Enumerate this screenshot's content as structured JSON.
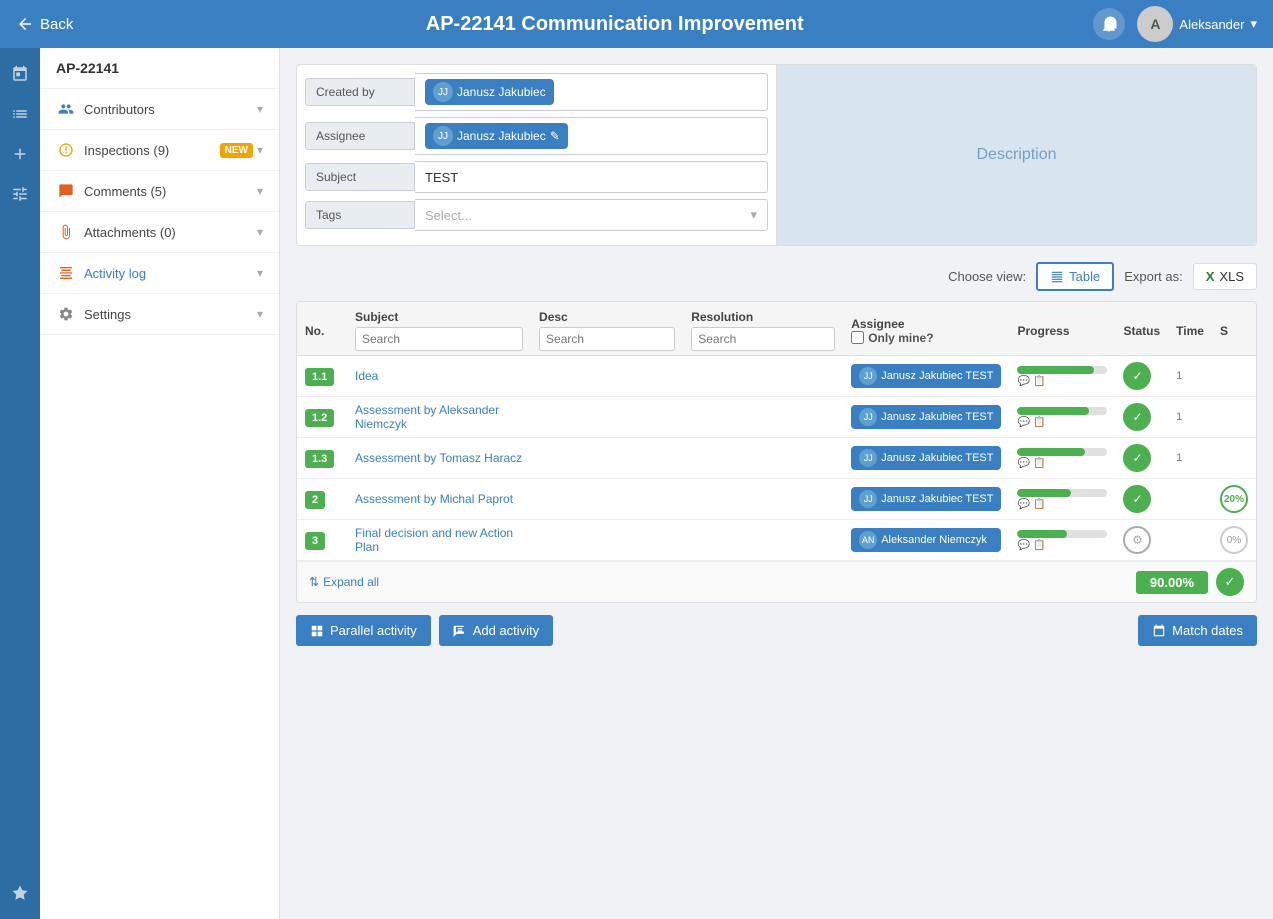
{
  "topbar": {
    "back_label": "Back",
    "title": "AP-22141 Communication Improvement",
    "user_name": "Aleksander",
    "user_initials": "A"
  },
  "sidebar": {
    "icons": [
      "calendar",
      "list",
      "plus",
      "sliders",
      "star"
    ]
  },
  "nav": {
    "project_id": "AP-22141",
    "items": [
      {
        "id": "contributors",
        "label": "Contributors",
        "icon": "person",
        "badge": null,
        "has_chevron": true
      },
      {
        "id": "inspections",
        "label": "Inspections (9)",
        "icon": "inspect",
        "badge": "NEW",
        "has_chevron": true
      },
      {
        "id": "comments",
        "label": "Comments (5)",
        "icon": "comment",
        "badge": null,
        "has_chevron": true
      },
      {
        "id": "attachments",
        "label": "Attachments (0)",
        "icon": "attach",
        "badge": null,
        "has_chevron": true
      },
      {
        "id": "activity_log",
        "label": "Activity log",
        "icon": "activity",
        "badge": null,
        "has_chevron": true,
        "active": true
      },
      {
        "id": "settings",
        "label": "Settings",
        "icon": "gear",
        "badge": null,
        "has_chevron": true
      }
    ]
  },
  "form": {
    "created_by_label": "Created by",
    "created_by_value": "Janusz Jakubiec",
    "assignee_label": "Assignee",
    "assignee_value": "Janusz Jakubiec",
    "subject_label": "Subject",
    "subject_value": "TEST",
    "tags_label": "Tags",
    "tags_placeholder": "Select...",
    "description_label": "Description"
  },
  "table_controls": {
    "choose_view_label": "Choose view:",
    "table_label": "Table",
    "export_label": "Export as:",
    "xls_label": "XLS"
  },
  "table": {
    "columns": [
      "No.",
      "Subject",
      "Desc",
      "Resolution",
      "Assignee",
      "Progress",
      "Status",
      "Time",
      "S"
    ],
    "subject_search_placeholder": "Search",
    "desc_search_placeholder": "Search",
    "resolution_search_placeholder": "Search",
    "only_mine_label": "Only mine?",
    "rows": [
      {
        "num": "1.1",
        "subject": "Idea",
        "desc": "",
        "resolution": "",
        "assignee": "Janusz Jakubiec TEST",
        "progress": 85,
        "status": "check",
        "time": "1",
        "s": ""
      },
      {
        "num": "1.2",
        "subject": "Assessment by Aleksander Niemczyk",
        "desc": "",
        "resolution": "",
        "assignee": "Janusz Jakubiec TEST",
        "progress": 80,
        "status": "check",
        "time": "1",
        "s": ""
      },
      {
        "num": "1.3",
        "subject": "Assessment by Tomasz Haracz",
        "desc": "",
        "resolution": "",
        "assignee": "Janusz Jakubiec TEST",
        "progress": 75,
        "status": "check",
        "time": "1",
        "s": ""
      },
      {
        "num": "2",
        "subject": "Assessment by Michal Paprot",
        "desc": "",
        "resolution": "",
        "assignee": "Janusz Jakubiec TEST",
        "progress": 60,
        "status": "check",
        "time": "",
        "s": "20%"
      },
      {
        "num": "3",
        "subject": "Final decision and new Action Plan",
        "desc": "",
        "resolution": "",
        "assignee": "Aleksander Niemczyk",
        "progress": 55,
        "status": "gear",
        "time": "",
        "s": "0%"
      }
    ],
    "total_progress": "90.00%",
    "expand_label": "Expand all"
  },
  "buttons": {
    "parallel_activity": "Parallel activity",
    "add_activity": "Add activity",
    "match_dates": "Match dates"
  }
}
